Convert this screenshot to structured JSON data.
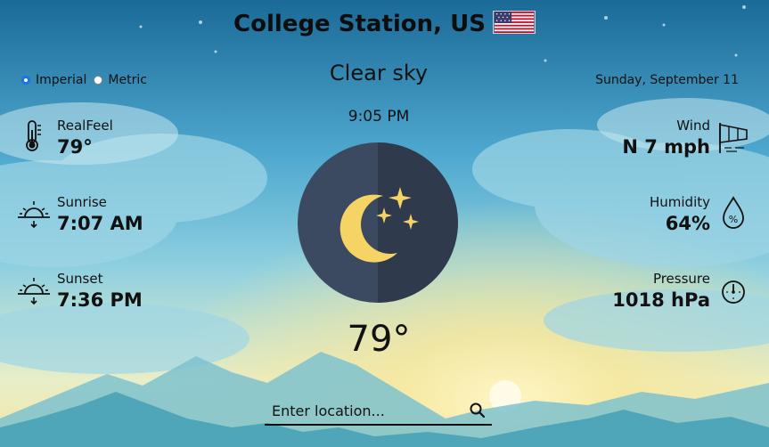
{
  "header": {
    "city": "College Station, US",
    "flag_icon": "us-flag-icon"
  },
  "units": {
    "imperial_label": "Imperial",
    "metric_label": "Metric",
    "selected": "Imperial"
  },
  "current": {
    "condition": "Clear sky",
    "date": "Sunday, September 11",
    "time": "9:05 PM",
    "temperature": "79°",
    "icon": "clear-night-icon"
  },
  "left_stats": {
    "realfeel": {
      "label": "RealFeel",
      "value": "79°",
      "icon": "thermometer-icon"
    },
    "sunrise": {
      "label": "Sunrise",
      "value": "7:07 AM",
      "icon": "sunrise-icon"
    },
    "sunset": {
      "label": "Sunset",
      "value": "7:36 PM",
      "icon": "sunset-icon"
    }
  },
  "right_stats": {
    "wind": {
      "label": "Wind",
      "value": "N 7 mph",
      "icon": "windsock-icon"
    },
    "humidity": {
      "label": "Humidity",
      "value": "64%",
      "icon": "humidity-drop-icon"
    },
    "pressure": {
      "label": "Pressure",
      "value": "1018 hPa",
      "icon": "gauge-icon"
    }
  },
  "search": {
    "placeholder": "Enter location...",
    "icon": "search-icon"
  },
  "colors": {
    "sky_top": "#1f6f9c",
    "sky_mid": "#64b8d4",
    "sun_glow": "#f6e9a8",
    "moon": "#f6d365",
    "icon_circle": "#3c4a61",
    "radio_accent": "#1a73e8"
  }
}
